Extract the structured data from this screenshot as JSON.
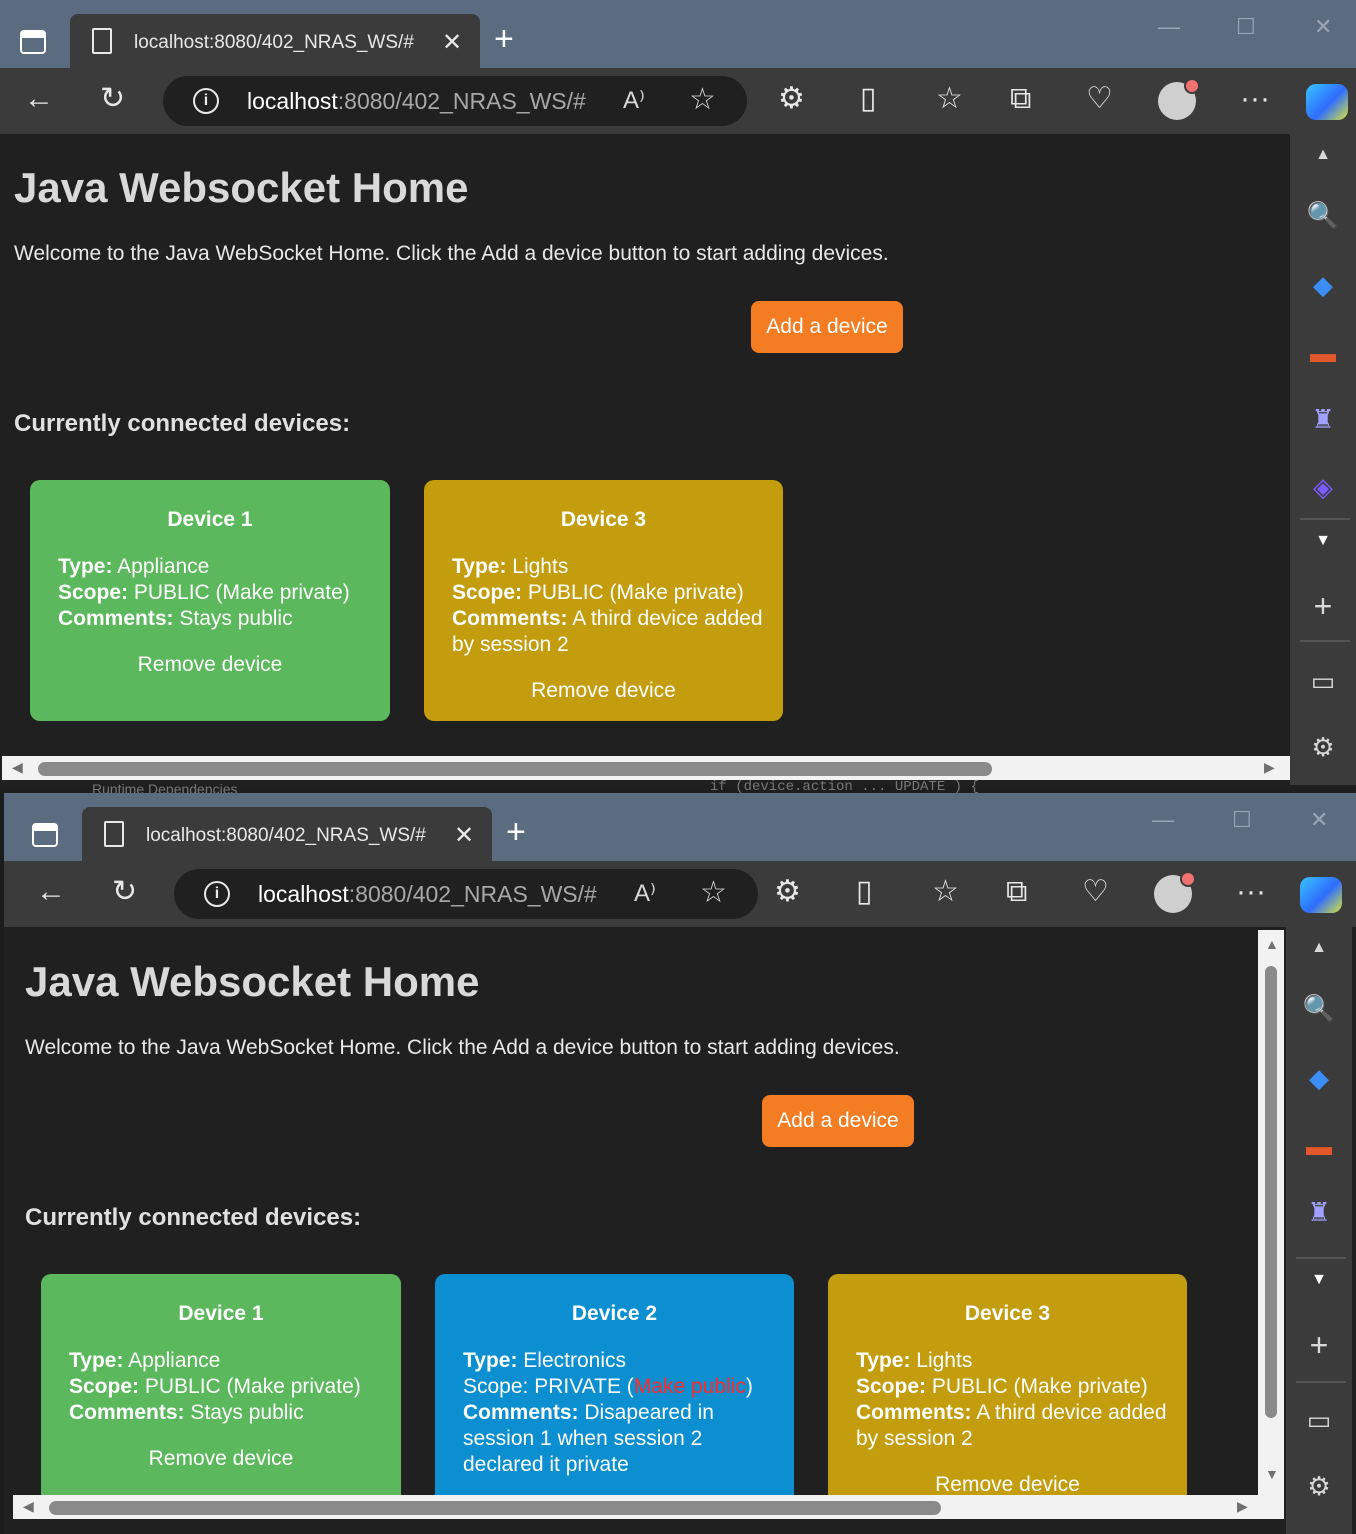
{
  "browser": {
    "tab_title": "localhost:8080/402_NRAS_WS/#",
    "url_host": "localhost",
    "url_rest": ":8080/402_NRAS_WS/#",
    "new_tab": "+",
    "close_tab": "✕",
    "read_aloud": "À",
    "more": "···"
  },
  "ide_background_text": {
    "left": "Runtime Dependencies",
    "right": "if (device.action  ...  UPDATE ) {"
  },
  "page": {
    "title": "Java Websocket Home",
    "welcome": "Welcome to the Java WebSocket Home. Click the Add a device button to start adding devices.",
    "add_button": "Add a device",
    "connected_heading": "Currently connected devices:"
  },
  "labels": {
    "type": "Type:",
    "scope": "Scope:",
    "scope_plain": "Scope: ",
    "comments": "Comments:",
    "remove": "Remove device"
  },
  "window1": {
    "devices": [
      {
        "name": "Device 1",
        "type": " Appliance",
        "scope": " PUBLIC (Make private)",
        "comments": " Stays public",
        "color": "#5cb85c"
      },
      {
        "name": "Device 3",
        "type": " Lights",
        "scope": " PUBLIC (Make private)",
        "comments": " A third device added by session 2",
        "color": "#c49d0e"
      }
    ]
  },
  "window2": {
    "devices": [
      {
        "name": "Device 1",
        "type": " Appliance",
        "scope": " PUBLIC (Make private)",
        "comments": " Stays public",
        "color": "#5cb85c"
      },
      {
        "name": "Device 2",
        "type": " Electronics",
        "scope_prefix": "PRIVATE (",
        "scope_link": "Make public",
        "scope_suffix": ")",
        "comments": " Disapeared in session 1 when session 2 declared it private",
        "color": "#0c8fd1"
      },
      {
        "name": "Device 3",
        "type": " Lights",
        "scope": " PUBLIC (Make private)",
        "comments": " A third device added by session 2",
        "color": "#c49d0e"
      }
    ]
  },
  "colors": {
    "accent_button": "#f47c22",
    "make_public_link": "#ff2a2a",
    "tabstrip": "#5b6b80"
  }
}
